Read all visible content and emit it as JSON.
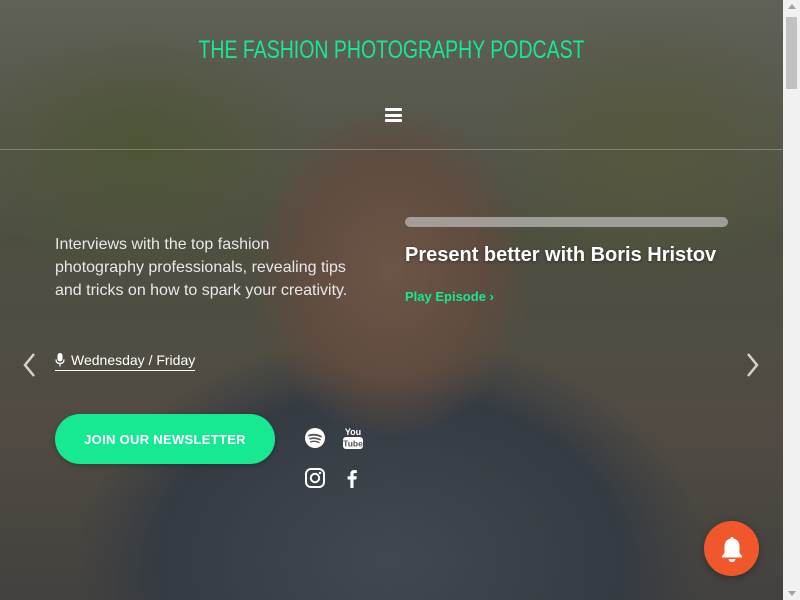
{
  "header": {
    "site_title": "THE FASHION PHOTOGRAPHY PODCAST",
    "menu_icon": "hamburger-menu-icon"
  },
  "hero": {
    "tagline": "Interviews with the top fashion photography professionals, revealing tips and tricks on how to spark your creativity.",
    "schedule": "Wednesday / Friday",
    "schedule_icon": "microphone-icon",
    "newsletter_button": "JOIN OUR NEWSLETTER"
  },
  "episode": {
    "title": "Present better with Boris Hristov",
    "play_link": "Play Episode",
    "play_link_icon": "chevron-right-icon"
  },
  "social": [
    "spotify-icon",
    "youtube-icon",
    "instagram-icon",
    "facebook-icon"
  ],
  "colors": {
    "accent": "#17e892",
    "bell": "#f0572d"
  }
}
